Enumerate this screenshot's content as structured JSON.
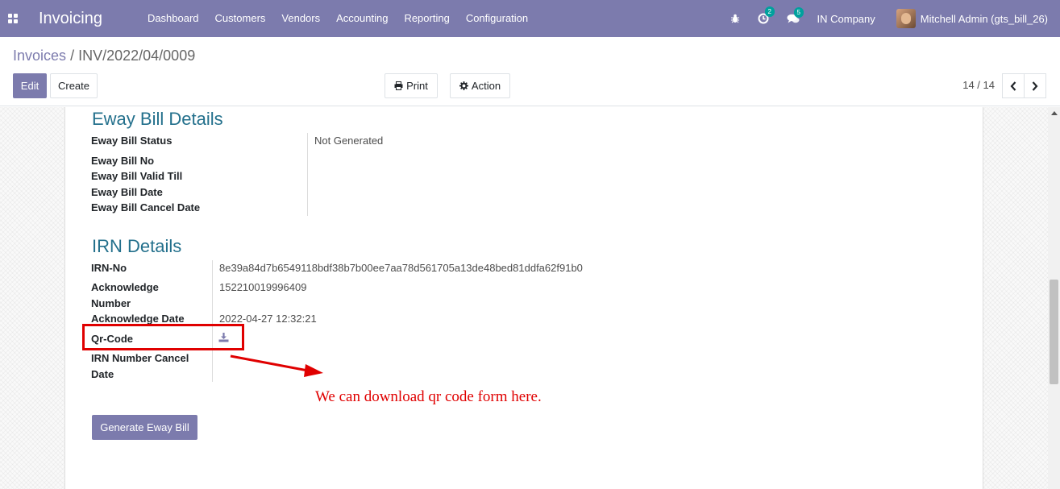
{
  "navbar": {
    "app_name": "Invoicing",
    "menu": [
      "Dashboard",
      "Customers",
      "Vendors",
      "Accounting",
      "Reporting",
      "Configuration"
    ],
    "activity_count": "2",
    "messages_count": "5",
    "company": "IN Company",
    "user": "Mitchell Admin (gts_bill_26)"
  },
  "breadcrumb": {
    "parent": "Invoices",
    "separator": "/",
    "current": "INV/2022/04/0009"
  },
  "buttons": {
    "edit": "Edit",
    "create": "Create",
    "print": "Print",
    "action": "Action"
  },
  "pager": {
    "value": "14 / 14"
  },
  "eway": {
    "title": "Eway Bill Details",
    "status_label": "Eway Bill Status",
    "status_value": "Not Generated",
    "no_label": "Eway Bill No",
    "valid_till_label": "Eway Bill Valid Till",
    "date_label": "Eway Bill Date",
    "cancel_date_label": "Eway Bill Cancel Date"
  },
  "irn": {
    "title": "IRN Details",
    "irn_no_label": "IRN-No",
    "irn_no_value": "8e39a84d7b6549118bdf38b7b00ee7aa78d561705a13de48bed81ddfa62f91b0",
    "ack_number_label_1": "Acknowledge",
    "ack_number_label_2": "Number",
    "ack_number_value": "152210019996409",
    "ack_date_label": "Acknowledge Date",
    "ack_date_value": "2022-04-27 12:32:21",
    "qr_code_label": "Qr-Code",
    "cancel_date_label_1": "IRN Number Cancel",
    "cancel_date_label_2": "Date"
  },
  "generate_button": "Generate Eway Bill",
  "annotation": "We can download qr code form here.",
  "colors": {
    "brand": "#7c7bad",
    "section_title": "#23708c",
    "annotation": "#e00000"
  }
}
